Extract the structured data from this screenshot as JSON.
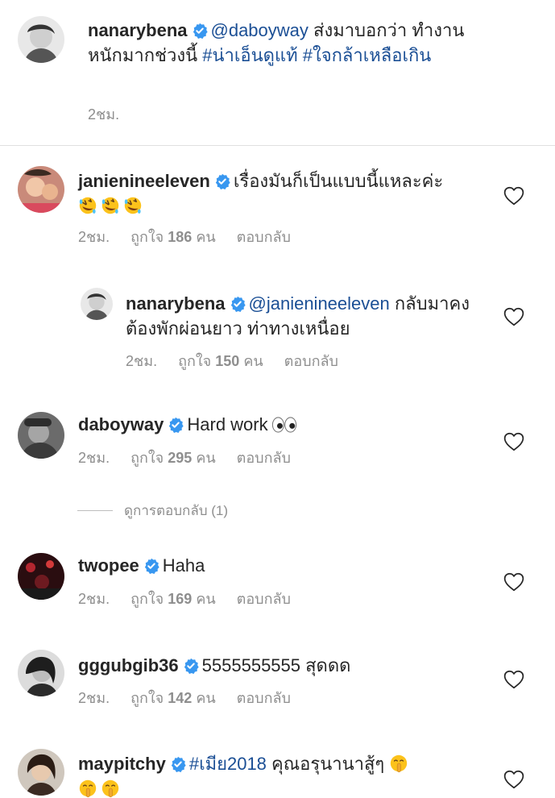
{
  "caption": {
    "username": "nanarybena",
    "mention": "@daboyway",
    "text": " ส่งมาบอกว่า ทำงานหนักมากช่วงนี้ ",
    "hashtag1": "#น่าเอ็นดูแท้",
    "hashtag2": "#ใจกล้าเหลือเกิน",
    "time": "2ชม."
  },
  "comments": [
    {
      "username": "janienineeleven",
      "text": "เรื่องมันก็เป็นแบบนี้แหละค่ะ",
      "emoji": [
        "rolling-laughing",
        "rolling-laughing",
        "rolling-laughing"
      ],
      "time": "2ชม.",
      "likes_prefix": "ถูกใจ",
      "likes": "186",
      "likes_suffix": "คน",
      "reply": "ตอบกลับ"
    },
    {
      "username": "nanarybena",
      "mention": "@janienineeleven",
      "text": " กลับมาคงต้องพักผ่อนยาว ท่าทางเหนื่อย",
      "time": "2ชม.",
      "likes_prefix": "ถูกใจ",
      "likes": "150",
      "likes_suffix": "คน",
      "reply": "ตอบกลับ"
    },
    {
      "username": "daboyway",
      "text": "Hard work",
      "emoji": [
        "eyes"
      ],
      "time": "2ชม.",
      "likes_prefix": "ถูกใจ",
      "likes": "295",
      "likes_suffix": "คน",
      "reply": "ตอบกลับ",
      "view_replies": "ดูการตอบกลับ (1)"
    },
    {
      "username": "twopee",
      "text": "Haha",
      "time": "2ชม.",
      "likes_prefix": "ถูกใจ",
      "likes": "169",
      "likes_suffix": "คน",
      "reply": "ตอบกลับ"
    },
    {
      "username": "gggubgib36",
      "text": "5555555555 สุดดด",
      "time": "2ชม.",
      "likes_prefix": "ถูกใจ",
      "likes": "142",
      "likes_suffix": "คน",
      "reply": "ตอบกลับ"
    },
    {
      "username": "maypitchy",
      "hashtag": "#เมีย2018",
      "text": " คุณอรุนานาสู้ๆ",
      "emoji": [
        "shushing",
        "shushing",
        "shushing"
      ]
    }
  ],
  "colors": {
    "text": "#262626",
    "meta": "#8e8e8e",
    "link": "#1b4f95",
    "verified": "#3897f0",
    "divider": "#e0e0e0"
  }
}
